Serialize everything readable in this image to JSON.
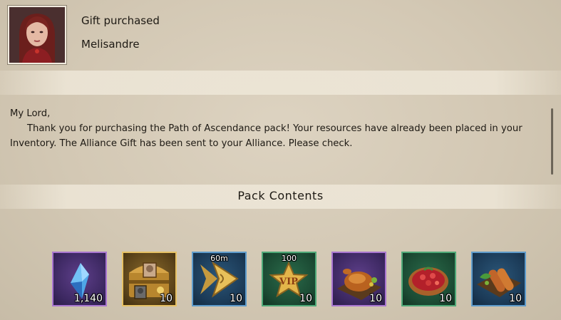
{
  "header": {
    "title": "Gift purchased",
    "sender": "Melisandre"
  },
  "message": {
    "greeting": "My Lord,",
    "body": "Thank you for purchasing the Path of Ascendance pack! Your resources have already been placed in your Inventory. The Alliance Gift has been sent to your Alliance. Please check."
  },
  "pack": {
    "section_title": "Pack Contents",
    "items": [
      {
        "icon": "blue-crystal-icon",
        "rarity": "purple",
        "quantity": "1,140",
        "top_label": ""
      },
      {
        "icon": "treasure-chest-icon",
        "rarity": "gold",
        "quantity": "10",
        "top_label": ""
      },
      {
        "icon": "speedup-arrow-icon",
        "rarity": "blue",
        "quantity": "10",
        "top_label": "60m"
      },
      {
        "icon": "vip-star-icon",
        "rarity": "green",
        "quantity": "10",
        "top_label": "100"
      },
      {
        "icon": "roast-chicken-icon",
        "rarity": "purple",
        "quantity": "10",
        "top_label": ""
      },
      {
        "icon": "fruit-pie-icon",
        "rarity": "green",
        "quantity": "10",
        "top_label": ""
      },
      {
        "icon": "sausage-platter-icon",
        "rarity": "blue",
        "quantity": "10",
        "top_label": ""
      }
    ]
  },
  "colors": {
    "purple_border": "#a977d0",
    "gold_border": "#e6c165",
    "blue_border": "#5f9ccc",
    "green_border": "#4fa978",
    "parchment": "#d3c8b4"
  }
}
